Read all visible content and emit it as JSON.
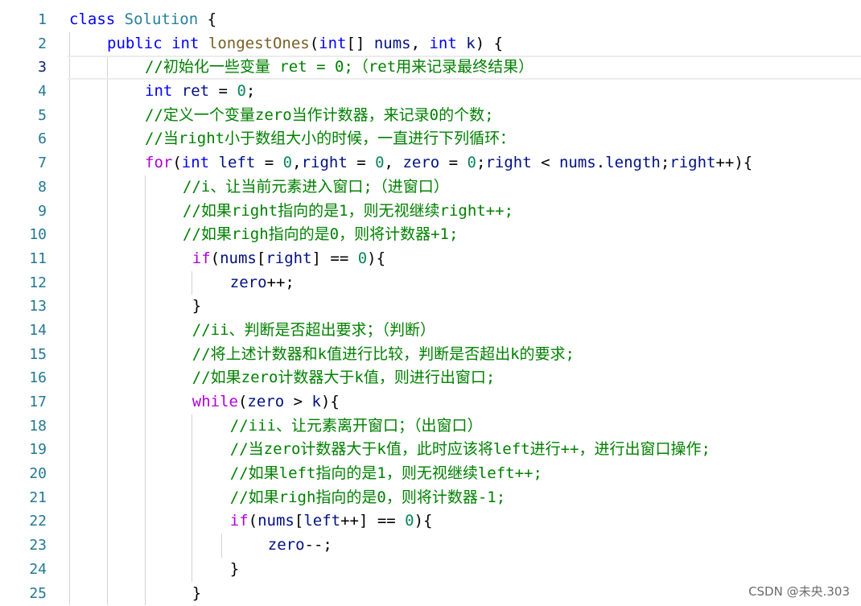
{
  "editor": {
    "language": "java",
    "current_line": 3,
    "lines": [
      {
        "n": "1",
        "indent": 0,
        "tokens": [
          [
            "kw",
            "class"
          ],
          [
            "op",
            " "
          ],
          [
            "type",
            "Solution"
          ],
          [
            "op",
            " {"
          ]
        ]
      },
      {
        "n": "2",
        "indent": 1,
        "tokens": [
          [
            "kw",
            "public"
          ],
          [
            "op",
            " "
          ],
          [
            "kw",
            "int"
          ],
          [
            "op",
            " "
          ],
          [
            "fn",
            "longestOnes"
          ],
          [
            "op",
            "("
          ],
          [
            "kw",
            "int"
          ],
          [
            "op",
            "[] "
          ],
          [
            "var",
            "nums"
          ],
          [
            "op",
            ", "
          ],
          [
            "kw",
            "int"
          ],
          [
            "op",
            " "
          ],
          [
            "var",
            "k"
          ],
          [
            "op",
            ") {"
          ]
        ]
      },
      {
        "n": "3",
        "indent": 2,
        "tokens": [
          [
            "cmt",
            "//初始化一些变量 ret = 0;（ret用来记录最终结果）"
          ]
        ]
      },
      {
        "n": "4",
        "indent": 2,
        "tokens": [
          [
            "kw",
            "int"
          ],
          [
            "op",
            " "
          ],
          [
            "var",
            "ret"
          ],
          [
            "op",
            " = "
          ],
          [
            "num",
            "0"
          ],
          [
            "op",
            ";"
          ]
        ]
      },
      {
        "n": "5",
        "indent": 2,
        "tokens": [
          [
            "cmt",
            "//定义一个变量zero当作计数器，来记录0的个数;"
          ]
        ]
      },
      {
        "n": "6",
        "indent": 2,
        "tokens": [
          [
            "cmt",
            "//当right小于数组大小的时候，一直进行下列循环："
          ]
        ]
      },
      {
        "n": "7",
        "indent": 2,
        "tokens": [
          [
            "ctl",
            "for"
          ],
          [
            "op",
            "("
          ],
          [
            "kw",
            "int"
          ],
          [
            "op",
            " "
          ],
          [
            "var",
            "left"
          ],
          [
            "op",
            " = "
          ],
          [
            "num",
            "0"
          ],
          [
            "op",
            ","
          ],
          [
            "var",
            "right"
          ],
          [
            "op",
            " = "
          ],
          [
            "num",
            "0"
          ],
          [
            "op",
            ", "
          ],
          [
            "var",
            "zero"
          ],
          [
            "op",
            " = "
          ],
          [
            "num",
            "0"
          ],
          [
            "op",
            ";"
          ],
          [
            "var",
            "right"
          ],
          [
            "op",
            " < "
          ],
          [
            "var",
            "nums"
          ],
          [
            "op",
            "."
          ],
          [
            "var",
            "length"
          ],
          [
            "op",
            ";"
          ],
          [
            "var",
            "right"
          ],
          [
            "op",
            "++){"
          ]
        ]
      },
      {
        "n": "8",
        "indent": 3,
        "tokens": [
          [
            "cmt",
            "//i、让当前元素进入窗口;（进窗口）"
          ]
        ]
      },
      {
        "n": "9",
        "indent": 3,
        "tokens": [
          [
            "cmt",
            "//如果right指向的是1，则无视继续right++;"
          ]
        ]
      },
      {
        "n": "10",
        "indent": 3,
        "tokens": [
          [
            "cmt",
            "//如果righ指向的是0，则将计数器+1;"
          ]
        ]
      },
      {
        "n": "11",
        "indent": 3.25,
        "tokens": [
          [
            "ctl",
            "if"
          ],
          [
            "op",
            "("
          ],
          [
            "var",
            "nums"
          ],
          [
            "op",
            "["
          ],
          [
            "var",
            "right"
          ],
          [
            "op",
            "] == "
          ],
          [
            "num",
            "0"
          ],
          [
            "op",
            "){"
          ]
        ]
      },
      {
        "n": "12",
        "indent": 4.25,
        "tokens": [
          [
            "var",
            "zero"
          ],
          [
            "op",
            "++;"
          ]
        ]
      },
      {
        "n": "13",
        "indent": 3.25,
        "tokens": [
          [
            "op",
            "}"
          ]
        ]
      },
      {
        "n": "14",
        "indent": 3.25,
        "tokens": [
          [
            "cmt",
            "//ii、判断是否超出要求；（判断）"
          ]
        ]
      },
      {
        "n": "15",
        "indent": 3.25,
        "tokens": [
          [
            "cmt",
            "//将上述计数器和k值进行比较，判断是否超出k的要求;"
          ]
        ]
      },
      {
        "n": "16",
        "indent": 3.25,
        "tokens": [
          [
            "cmt",
            "//如果zero计数器大于k值，则进行出窗口;"
          ]
        ]
      },
      {
        "n": "17",
        "indent": 3.25,
        "tokens": [
          [
            "ctl",
            "while"
          ],
          [
            "op",
            "("
          ],
          [
            "var",
            "zero"
          ],
          [
            "op",
            " > "
          ],
          [
            "var",
            "k"
          ],
          [
            "op",
            "){"
          ]
        ]
      },
      {
        "n": "18",
        "indent": 4.25,
        "tokens": [
          [
            "cmt",
            "//iii、让元素离开窗口；（出窗口）"
          ]
        ]
      },
      {
        "n": "19",
        "indent": 4.25,
        "tokens": [
          [
            "cmt",
            "//当zero计数器大于k值，此时应该将left进行++，进行出窗口操作;"
          ]
        ]
      },
      {
        "n": "20",
        "indent": 4.25,
        "tokens": [
          [
            "cmt",
            "//如果left指向的是1，则无视继续left++;"
          ]
        ]
      },
      {
        "n": "21",
        "indent": 4.25,
        "tokens": [
          [
            "cmt",
            "//如果righ指向的是0，则将计数器-1;"
          ]
        ]
      },
      {
        "n": "22",
        "indent": 4.25,
        "tokens": [
          [
            "ctl",
            "if"
          ],
          [
            "op",
            "("
          ],
          [
            "var",
            "nums"
          ],
          [
            "op",
            "["
          ],
          [
            "var",
            "left"
          ],
          [
            "op",
            "++] == "
          ],
          [
            "num",
            "0"
          ],
          [
            "op",
            "){"
          ]
        ]
      },
      {
        "n": "23",
        "indent": 5.25,
        "tokens": [
          [
            "var",
            "zero"
          ],
          [
            "op",
            "--;"
          ]
        ]
      },
      {
        "n": "24",
        "indent": 4.25,
        "tokens": [
          [
            "op",
            "}"
          ]
        ]
      },
      {
        "n": "25",
        "indent": 3.25,
        "tokens": [
          [
            "op",
            "}"
          ]
        ]
      }
    ]
  },
  "watermark": "CSDN @未央.303",
  "colors": {
    "keyword": "#0000ff",
    "control": "#af00db",
    "type": "#267f99",
    "function": "#795e26",
    "number": "#098658",
    "variable": "#001080",
    "comment": "#008000",
    "line_number": "#237893"
  }
}
